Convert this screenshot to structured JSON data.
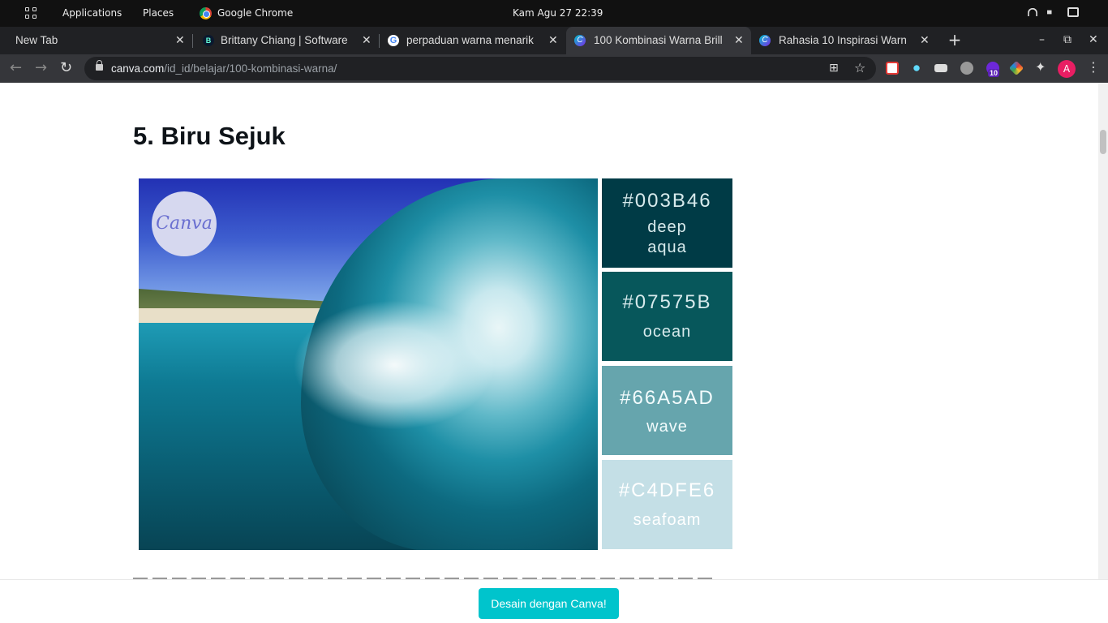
{
  "system_bar": {
    "applications": "Applications",
    "places": "Places",
    "active_app": "Google Chrome",
    "datetime": "Kam Agu 27  22:39"
  },
  "tabs": [
    {
      "title": "New Tab",
      "close": "✕"
    },
    {
      "title": "Brittany Chiang | Software",
      "close": "✕",
      "favicon": "B"
    },
    {
      "title": "perpaduan warna menarik",
      "close": "✕",
      "favicon": "G"
    },
    {
      "title": "100 Kombinasi Warna Brill",
      "close": "✕",
      "favicon": "C"
    },
    {
      "title": "Rahasia 10 Inspirasi Warn",
      "close": "✕",
      "favicon": "C"
    }
  ],
  "newtab": "+",
  "window_controls": {
    "minimize": "–",
    "maximize": "⧉",
    "close": "✕"
  },
  "toolbar": {
    "back": "←",
    "forward": "→",
    "reload": "↻",
    "url_domain": "canva.com",
    "url_path": "/id_id/belajar/100-kombinasi-warna/",
    "translate": "⊞",
    "star": "☆",
    "extensions": "✦",
    "ext_badge": "10",
    "avatar": "A",
    "menu": "⋮"
  },
  "article": {
    "heading": "5. Biru Sejuk",
    "logo": "Canva",
    "swatches": [
      {
        "hex": "#003B46",
        "name": "deep\naqua",
        "name1": "deep",
        "name2": "aqua",
        "bg": "#003b46",
        "fg": "#d7eaec"
      },
      {
        "hex": "#07575B",
        "name": "ocean",
        "bg": "#07575b",
        "fg": "#d7eaec"
      },
      {
        "hex": "#66A5AD",
        "name": "wave",
        "bg": "#66a5ad",
        "fg": "#f2fbfc"
      },
      {
        "hex": "#C4DFE6",
        "name": "seafoam",
        "bg": "#c4dfe6",
        "fg": "#ffffff"
      }
    ]
  },
  "cta": {
    "label": "Desain dengan Canva!",
    "color": "#00c4cc"
  }
}
